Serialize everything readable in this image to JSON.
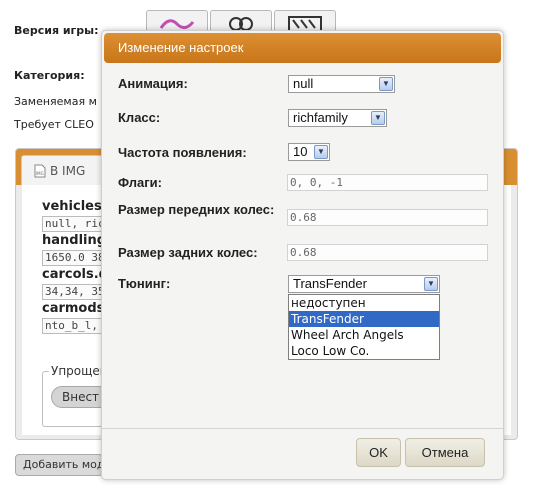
{
  "background": {
    "version_label": "Версия игры:",
    "category_label": "Категория:",
    "replaceable_label": "Заменяемая м",
    "requires_label": "Требует CLEO",
    "tab_label": "В IMG",
    "fields": [
      {
        "title": "vehicles.",
        "value": "null, richf"
      },
      {
        "title": "handling",
        "value": "1650.0 38"
      },
      {
        "title": "carcols.d",
        "value": "34,34, 35"
      },
      {
        "title": "carmods",
        "value": "nto_b_l, r"
      }
    ],
    "simplified_legend": "Упрощен",
    "apply_button": "Внест",
    "add_mod_button": "Добавить мод"
  },
  "modal": {
    "title": "Изменение настроек",
    "animation": {
      "label": "Анимация:",
      "value": "null"
    },
    "class": {
      "label": "Класс:",
      "value": "richfamily"
    },
    "frequency": {
      "label": "Частота появления:",
      "value": "10"
    },
    "flags": {
      "label": "Флаги:",
      "value": "0, 0, -1"
    },
    "front_wheels": {
      "label": "Размер передних колес:",
      "value": "0.68"
    },
    "rear_wheels": {
      "label": "Размер задних колес:",
      "value": "0.68"
    },
    "tuning": {
      "label": "Тюнинг:",
      "value": "TransFender",
      "options": [
        "недоступен",
        "TransFender",
        "Wheel Arch Angels",
        "Loco Low Co."
      ],
      "highlighted": "TransFender"
    },
    "ok_button": "OK",
    "cancel_button": "Отмена"
  },
  "colors": {
    "title_bar": "#d68627",
    "selected_option": "#3169c6",
    "tab_bar": "#d98e32"
  }
}
